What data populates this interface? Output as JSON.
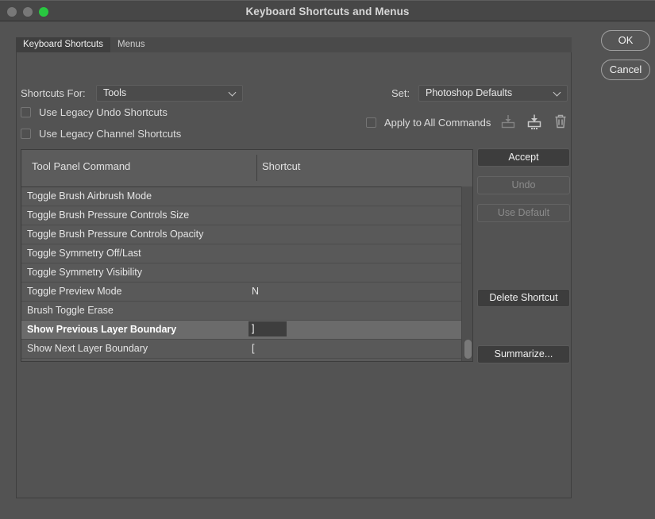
{
  "window": {
    "title": "Keyboard Shortcuts and Menus",
    "traffic": {
      "close": "close-button",
      "minimize": "minimize-button",
      "maximize": "maximize-button"
    }
  },
  "tabs": [
    {
      "label": "Keyboard Shortcuts",
      "active": true
    },
    {
      "label": "Menus",
      "active": false
    }
  ],
  "controls": {
    "shortcuts_for_label": "Shortcuts For:",
    "shortcuts_for_value": "Tools",
    "set_label": "Set:",
    "set_value": "Photoshop Defaults",
    "legacy_undo_label": "Use Legacy Undo Shortcuts",
    "legacy_undo_checked": false,
    "legacy_channel_label": "Use Legacy Channel Shortcuts",
    "legacy_channel_checked": false,
    "apply_all_label": "Apply to All Commands",
    "apply_all_checked": false,
    "icons": {
      "save_set": "save-set-icon",
      "save_set_as": "save-set-as-icon",
      "delete_set": "trash-icon"
    }
  },
  "table": {
    "columns": [
      "Tool Panel Command",
      "Shortcut"
    ],
    "rows": [
      {
        "command": "Toggle Brush Airbrush Mode",
        "shortcut": "",
        "selected": false,
        "editing": false
      },
      {
        "command": "Toggle Brush Pressure Controls Size",
        "shortcut": "",
        "selected": false,
        "editing": false
      },
      {
        "command": "Toggle Brush Pressure Controls Opacity",
        "shortcut": "",
        "selected": false,
        "editing": false
      },
      {
        "command": "Toggle Symmetry Off/Last",
        "shortcut": "",
        "selected": false,
        "editing": false
      },
      {
        "command": "Toggle Symmetry Visibility",
        "shortcut": "",
        "selected": false,
        "editing": false
      },
      {
        "command": "Toggle Preview Mode",
        "shortcut": "N",
        "selected": false,
        "editing": false
      },
      {
        "command": "Brush Toggle Erase",
        "shortcut": "",
        "selected": false,
        "editing": false
      },
      {
        "command": "Show Previous Layer Boundary",
        "shortcut": "]",
        "selected": true,
        "editing": true
      },
      {
        "command": "Show Next Layer Boundary",
        "shortcut": "[",
        "selected": false,
        "editing": false
      }
    ]
  },
  "side_buttons": {
    "accept": {
      "label": "Accept",
      "enabled": true
    },
    "undo": {
      "label": "Undo",
      "enabled": false
    },
    "use_default": {
      "label": "Use Default",
      "enabled": false
    },
    "delete_shortcut": {
      "label": "Delete Shortcut",
      "enabled": true
    },
    "summarize": {
      "label": "Summarize...",
      "enabled": true
    }
  },
  "dialog_buttons": {
    "ok": "OK",
    "cancel": "Cancel"
  },
  "colors": {
    "window_bg": "#535353",
    "titlebar_bg": "#474747",
    "table_row_bg": "#595959",
    "selected_row_bg": "#6b6b6b",
    "edit_field_bg": "#3e3e3e",
    "maximize_green": "#28c840"
  }
}
